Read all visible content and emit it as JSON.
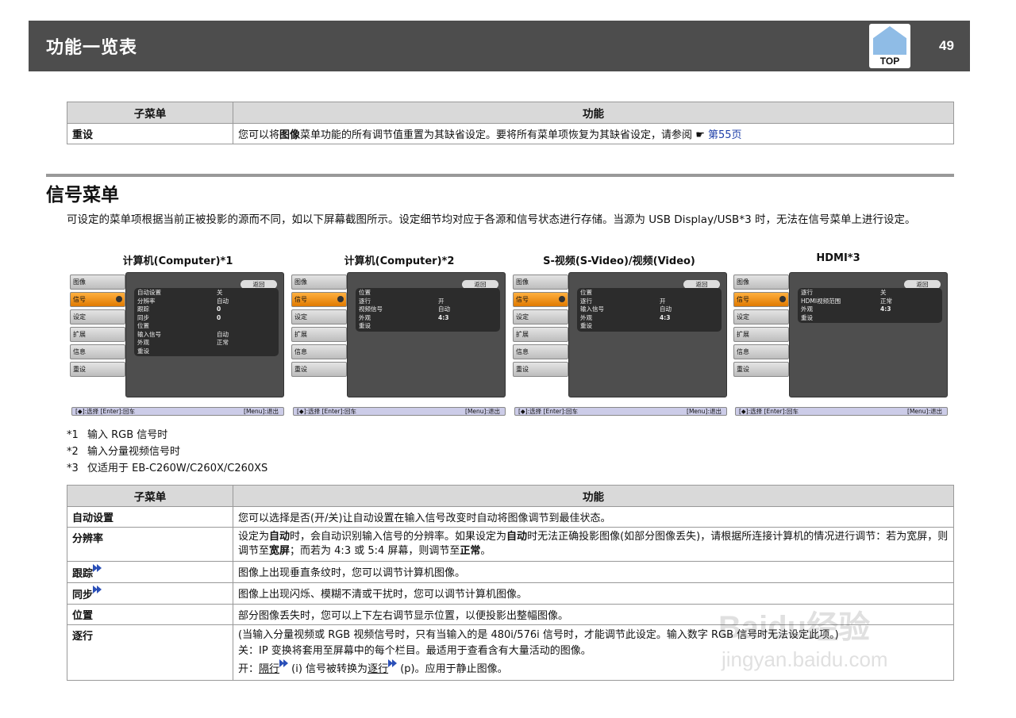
{
  "header": {
    "title": "功能一览表",
    "top_label": "TOP",
    "page_number": "49"
  },
  "table1": {
    "col_sub": "子菜单",
    "col_func": "功能",
    "rows": [
      {
        "sub": "重设",
        "pre": "您可以将",
        "bold": "图像",
        "post": "菜单功能的所有调节值重置为其缺省设定。要将所有菜单项恢复为其缺省设定，请参阅",
        "hand": "☛",
        "link": "第55页"
      }
    ]
  },
  "section": {
    "title": "信号菜单",
    "intro": "可设定的菜单项根据当前正被投影的源而不同，如以下屏幕截图所示。设定细节均对应于各源和信号状态进行存储。当源为 USB Display/USB*3 时，无法在信号菜单上进行设定。"
  },
  "screens": [
    {
      "caption": "计算机(Computer)*1",
      "menu": [
        "图像",
        "信号",
        "设定",
        "扩展",
        "信息",
        "重设"
      ],
      "back": "返回",
      "rows": [
        {
          "label": "自动设置",
          "value": "关",
          "bold": false
        },
        {
          "label": "分辨率",
          "value": "自动",
          "bold": false
        },
        {
          "label": "跟踪",
          "value": "0",
          "bold": true
        },
        {
          "label": "同步",
          "value": "0",
          "bold": true
        },
        {
          "label": "位置",
          "value": "",
          "bold": false
        },
        {
          "label": "输入信号",
          "value": "自动",
          "bold": false
        },
        {
          "label": "外观",
          "value": "正常",
          "bold": false
        },
        {
          "label": "重设",
          "value": "",
          "bold": false
        }
      ],
      "status_left": "[◆]:选择 [Enter]:回车",
      "status_right": "[Menu]:退出"
    },
    {
      "caption": "计算机(Computer)*2",
      "menu": [
        "图像",
        "信号",
        "设定",
        "扩展",
        "信息",
        "重设"
      ],
      "back": "返回",
      "rows": [
        {
          "label": "位置",
          "value": "",
          "bold": false
        },
        {
          "label": "逐行",
          "value": "开",
          "bold": false
        },
        {
          "label": "视频信号",
          "value": "自动",
          "bold": false
        },
        {
          "label": "外观",
          "value": "4:3",
          "bold": true
        },
        {
          "label": "重设",
          "value": "",
          "bold": false
        }
      ],
      "status_left": "[◆]:选择 [Enter]:回车",
      "status_right": "[Menu]:退出"
    },
    {
      "caption": "S-视频(S-Video)/视频(Video)",
      "menu": [
        "图像",
        "信号",
        "设定",
        "扩展",
        "信息",
        "重设"
      ],
      "back": "返回",
      "rows": [
        {
          "label": "位置",
          "value": "",
          "bold": false
        },
        {
          "label": "逐行",
          "value": "开",
          "bold": false
        },
        {
          "label": "输入信号",
          "value": "自动",
          "bold": false
        },
        {
          "label": "外观",
          "value": "4:3",
          "bold": true
        },
        {
          "label": "重设",
          "value": "",
          "bold": false
        }
      ],
      "status_left": "[◆]:选择 [Enter]:回车",
      "status_right": "[Menu]:退出"
    },
    {
      "caption": "HDMI*3",
      "menu": [
        "图像",
        "信号",
        "设定",
        "扩展",
        "信息",
        "重设"
      ],
      "back": "返回",
      "rows": [
        {
          "label": "逐行",
          "value": "关",
          "bold": false
        },
        {
          "label": "HDMI视频范围",
          "value": "正常",
          "bold": false
        },
        {
          "label": "外观",
          "value": "4:3",
          "bold": true
        },
        {
          "label": "重设",
          "value": "",
          "bold": false
        }
      ],
      "status_left": "[◆]:选择 [Enter]:回车",
      "status_right": "[Menu]:退出"
    }
  ],
  "footnotes": [
    {
      "mark": "*1",
      "text": "输入 RGB 信号时"
    },
    {
      "mark": "*2",
      "text": "输入分量视频信号时"
    },
    {
      "mark": "*3",
      "text": "仅适用于 EB-C260W/C260X/C260XS"
    }
  ],
  "table2": {
    "col_sub": "子菜单",
    "col_func": "功能",
    "r1": {
      "sub": "自动设置",
      "text": "您可以选择是否(开/关)让自动设置在输入信号改变时自动将图像调节到最佳状态。"
    },
    "r2": {
      "sub": "分辨率",
      "a": "设定为",
      "b1": "自动",
      "c": "时，会自动识别输入信号的分辨率。如果设定为",
      "b2": "自动",
      "d": "时无法正确投影图像(如部分图像丢失)，请根据所连接计算机的情况进行调节：若为宽屏，则调节至",
      "b3": "宽屏",
      "e": "；而若为 4:3 或 5:4 屏幕，则调节至",
      "b4": "正常",
      "f": "。"
    },
    "r3": {
      "sub": "跟踪",
      "text": "图像上出现垂直条纹时，您可以调节计算机图像。"
    },
    "r4": {
      "sub": "同步",
      "text": "图像上出现闪烁、模糊不清或干扰时，您可以调节计算机图像。"
    },
    "r5": {
      "sub": "位置",
      "text": "部分图像丢失时，您可以上下左右调节显示位置，以便投影出整幅图像。"
    },
    "r6": {
      "sub": "逐行",
      "line1": "(当输入分量视频或 RGB 视频信号时，只有当输入的是 480i/576i 信号时，才能调节此设定。输入数字 RGB 信号时无法设定此项。)",
      "line2": "关：IP 变换将套用至屏幕中的每个栏目。最适用于查看含有大量活动的图像。",
      "line3_a": "开：",
      "line3_link1": "隔行",
      "line3_b": " (i) 信号被转换为",
      "line3_link2": "逐行",
      "line3_c": " (p)。应用于静止图像。"
    }
  },
  "watermark": {
    "brand": "Baidu经验",
    "url": "jingyan.baidu.com"
  }
}
